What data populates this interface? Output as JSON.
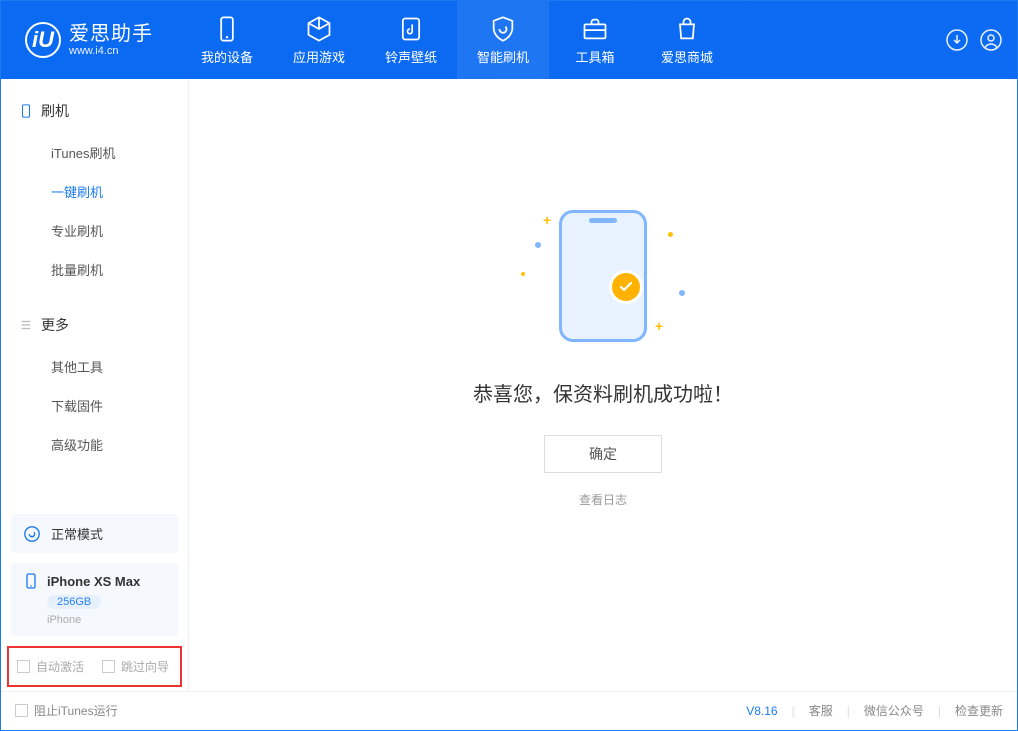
{
  "app": {
    "name_cn": "爱思助手",
    "name_en": "www.i4.cn"
  },
  "nav": {
    "mydevice": "我的设备",
    "apps": "应用游戏",
    "ringwall": "铃声壁纸",
    "flash": "智能刷机",
    "toolbox": "工具箱",
    "store": "爱思商城"
  },
  "sidebar": {
    "section1": "刷机",
    "items1": [
      "iTunes刷机",
      "一键刷机",
      "专业刷机",
      "批量刷机"
    ],
    "section2": "更多",
    "items2": [
      "其他工具",
      "下载固件",
      "高级功能"
    ]
  },
  "device": {
    "mode": "正常模式",
    "name": "iPhone XS Max",
    "capacity": "256GB",
    "type": "iPhone"
  },
  "options": {
    "auto_activate": "自动激活",
    "skip_guide": "跳过向导"
  },
  "content": {
    "success": "恭喜您，保资料刷机成功啦！",
    "ok": "确定",
    "view_log": "查看日志"
  },
  "footer": {
    "block_itunes": "阻止iTunes运行",
    "version": "V8.16",
    "support": "客服",
    "wechat": "微信公众号",
    "update": "检查更新"
  }
}
